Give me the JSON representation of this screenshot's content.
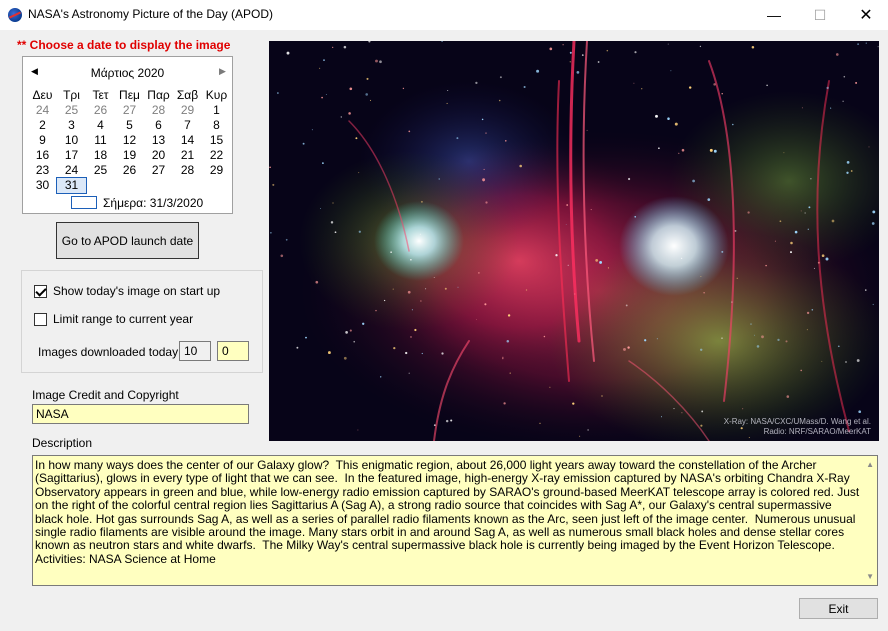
{
  "window": {
    "title": "NASA's Astronomy Picture of the Day (APOD)",
    "icon": "nasa-logo-icon",
    "controls": {
      "minimize": "—",
      "maximize": "☐",
      "close": "✕"
    }
  },
  "hint": "** Choose a date to display the image",
  "calendar": {
    "month_label": "Μάρτιος 2020",
    "prev_arrow": "◀",
    "next_arrow": "▶",
    "weekdays": [
      "Δευ",
      "Τρι",
      "Τετ",
      "Πεμ",
      "Παρ",
      "Σαβ",
      "Κυρ"
    ],
    "weeks": [
      [
        "24",
        "25",
        "26",
        "27",
        "28",
        "29",
        "1"
      ],
      [
        "2",
        "3",
        "4",
        "5",
        "6",
        "7",
        "8"
      ],
      [
        "9",
        "10",
        "11",
        "12",
        "13",
        "14",
        "15"
      ],
      [
        "16",
        "17",
        "18",
        "19",
        "20",
        "21",
        "22"
      ],
      [
        "23",
        "24",
        "25",
        "26",
        "27",
        "28",
        "29"
      ],
      [
        "30",
        "31",
        "",
        "",
        "",
        "",
        ""
      ]
    ],
    "selected": "31",
    "today_label": "Σήμερα: 31/3/2020"
  },
  "launch_button": "Go to APOD launch date",
  "options": {
    "show_today": {
      "label": "Show today's image on start up",
      "checked": true
    },
    "limit_range": {
      "label": "Limit range to current year",
      "checked": false
    },
    "downloads_label": "Images downloaded today:.",
    "downloads_limit": "10",
    "downloads_count": "0"
  },
  "credit": {
    "label": "Image Credit and Copyright",
    "value": "NASA"
  },
  "description": {
    "label": "Description",
    "text": "In how many ways does the center of our Galaxy glow?  This enigmatic region, about 26,000 light years away toward the constellation of the Archer (Sagittarius), glows in every type of light that we can see.  In the featured image, high-energy X-ray emission captured by NASA's orbiting Chandra X-Ray Observatory appears in green and blue, while low-energy radio emission captured by SARAO's ground-based MeerKAT telescope array is colored red. Just on the right of the colorful central region lies Sagittarius A (Sag A), a strong radio source that coincides with Sag A*, our Galaxy's central supermassive black hole. Hot gas surrounds Sag A, as well as a series of parallel radio filaments known as the Arc, seen just left of the image center.  Numerous unusual single radio filaments are visible around the image. Many stars orbit in and around Sag A, as well as numerous small black holes and dense stellar cores known as neutron stars and white dwarfs.  The Milky Way's central supermassive black hole is currently being imaged by the Event Horizon Telescope.   Activities: NASA Science at Home"
  },
  "image": {
    "credit_lines": [
      "X-Ray: NASA/CXC/UMass/D. Wang et al.",
      "Radio: NRF/SARAO/MeerKAT"
    ]
  },
  "exit_button": "Exit",
  "colors": {
    "hint": "#e00000",
    "field_bg": "#ffffc0",
    "window_bg": "#f0f0f0",
    "selection": "#1c5fb8"
  }
}
